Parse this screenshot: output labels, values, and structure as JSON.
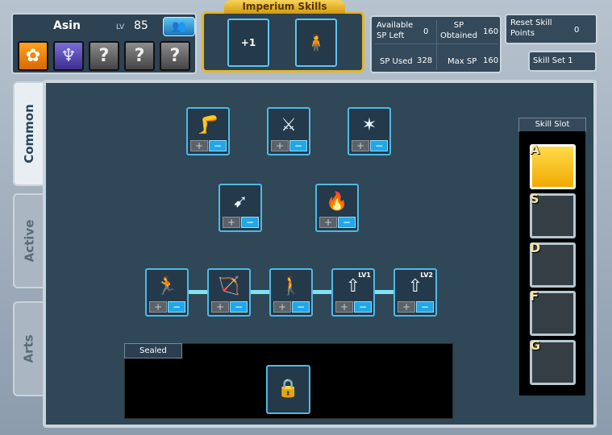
{
  "character": {
    "name": "Asin",
    "lv_label": "LV",
    "level": "85"
  },
  "class_slots": [
    "?",
    "?",
    "?"
  ],
  "imperium": {
    "title": "Imperium Skills",
    "slot1_label": "+1"
  },
  "stats": {
    "available_label": "Available SP Left",
    "available_value": "0",
    "obtained_label": "SP Obtained",
    "obtained_value": "160",
    "used_label": "SP Used",
    "used_value": "328",
    "max_label": "Max SP",
    "max_value": "160"
  },
  "reset": {
    "label": "Reset Skill Points",
    "value": "0"
  },
  "skill_set": {
    "label": "Skill Set 1"
  },
  "tabs": [
    "Common",
    "Active",
    "Arts"
  ],
  "skills": {
    "plus_glyph": "+",
    "minus_glyph": "−",
    "lv1_label": "LV1",
    "lv2_label": "LV2"
  },
  "sealed": {
    "label": "Sealed"
  },
  "skill_slots": {
    "header": "Skill Slot",
    "keys": [
      "A",
      "S",
      "D",
      "F",
      "G"
    ]
  }
}
